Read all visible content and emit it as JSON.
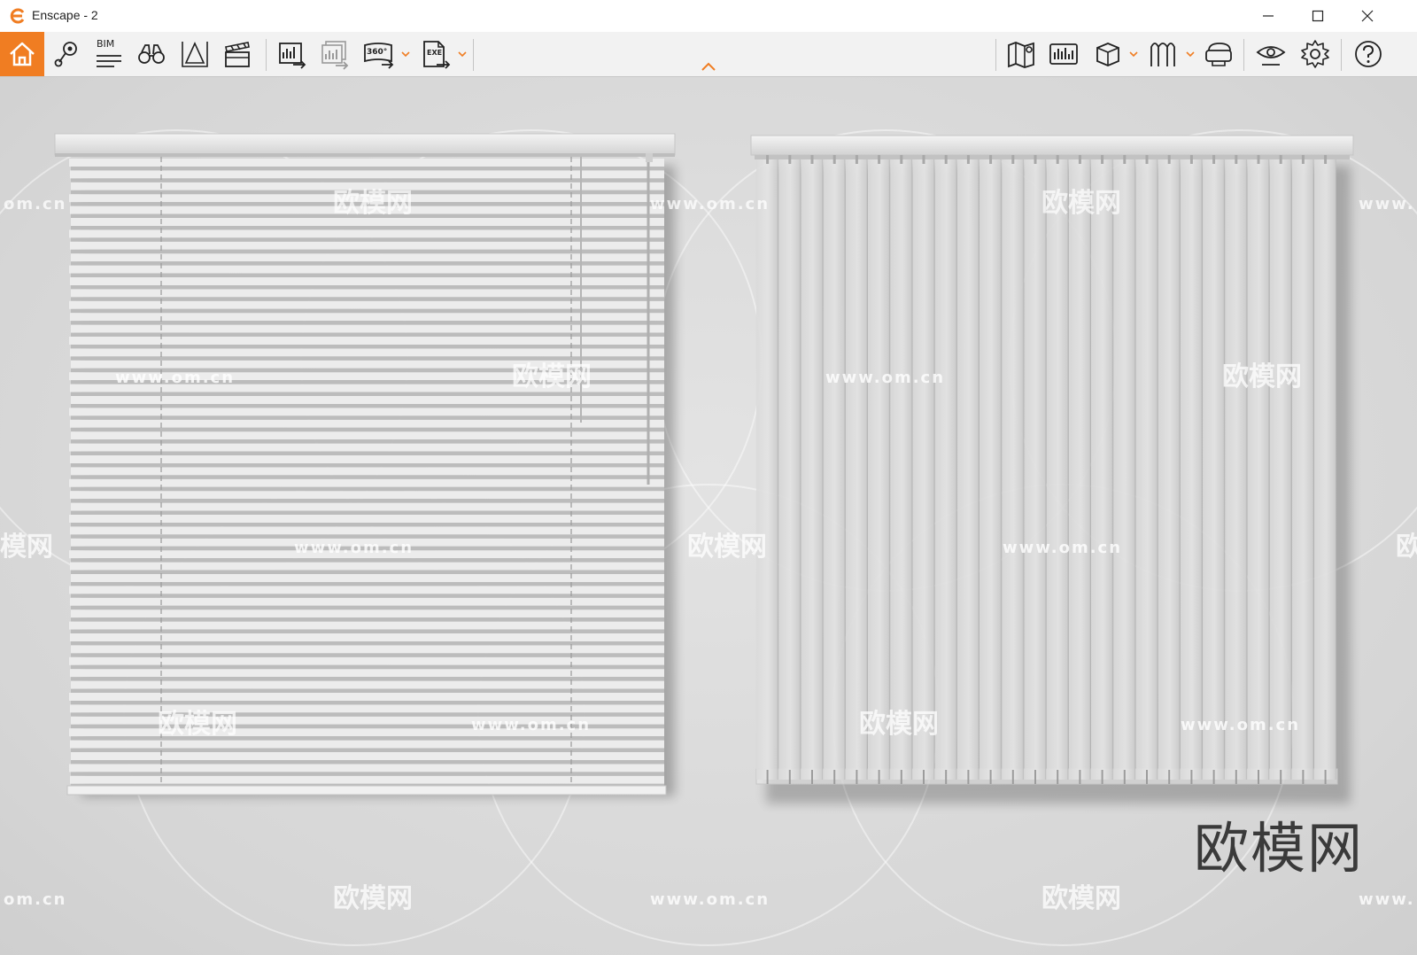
{
  "window": {
    "title": "Enscape - 2",
    "accent_color": "#f07d22"
  },
  "toolbar": {
    "bim_label": "BIM",
    "badge_360": "360°",
    "badge_exe": "EXE",
    "tools_left": [
      "home-icon",
      "location-pin-icon",
      "bim-list-icon",
      "binoculars-icon",
      "perspective-icon",
      "clapperboard-icon",
      "screenshot-export-icon",
      "batch-export-icon",
      "panorama-360-icon",
      "exe-export-icon"
    ],
    "tools_right": [
      "map-icon",
      "image-library-icon",
      "cube-icon",
      "asset-library-icon",
      "vr-headset-icon",
      "eye-settings-icon",
      "gear-icon",
      "help-icon"
    ]
  },
  "watermark": {
    "url": "www.om.cn",
    "url_partial": "om.cn",
    "url_prefix": "www.",
    "brand": "欧模网",
    "brand_partial": "模网",
    "brand_edge": "欧"
  },
  "corner_brand": "欧模网"
}
